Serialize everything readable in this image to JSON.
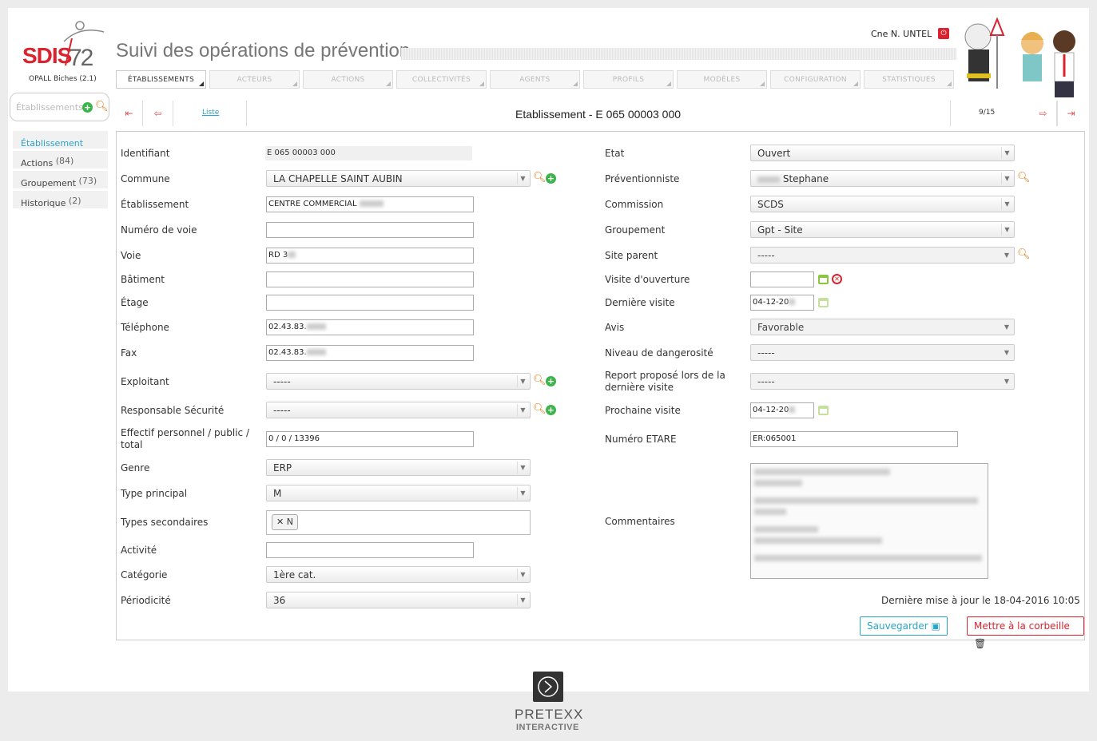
{
  "brand": {
    "logo_sdis": "SDIS",
    "logo_num": "72",
    "version": "OPALL Biches (2.1)",
    "title": "Suivi des opérations de prévention"
  },
  "user": {
    "name": "Cne N. UNTEL"
  },
  "nav": [
    "ÉTABLISSEMENTS",
    "ACTEURS",
    "ACTIONS",
    "COLLECTIVITÉS",
    "AGENTS",
    "PROFILS",
    "MODÈLES",
    "CONFIGURATION",
    "STATISTIQUES"
  ],
  "search": {
    "placeholder": "Établissements"
  },
  "sidebar": [
    {
      "label": "Établissement",
      "count": ""
    },
    {
      "label": "Actions",
      "count": "(84)"
    },
    {
      "label": "Groupement",
      "count": "(73)"
    },
    {
      "label": "Historique",
      "count": "(2)"
    }
  ],
  "record": {
    "list_link": "Liste",
    "title": "Etablissement - E 065 00003 000",
    "counter": "9/15"
  },
  "left": {
    "identifiant": {
      "label": "Identifiant",
      "value": "E 065 00003 000"
    },
    "commune": {
      "label": "Commune",
      "value": "LA CHAPELLE SAINT AUBIN"
    },
    "etablissement": {
      "label": "Établissement",
      "value": "CENTRE COMMERCIAL"
    },
    "numero_voie": {
      "label": "Numéro de voie",
      "value": ""
    },
    "voie": {
      "label": "Voie",
      "value": "RD 3"
    },
    "batiment": {
      "label": "Bâtiment",
      "value": ""
    },
    "etage": {
      "label": "Étage",
      "value": ""
    },
    "telephone": {
      "label": "Téléphone",
      "value": "02.43.83."
    },
    "fax": {
      "label": "Fax",
      "value": "02.43.83."
    },
    "exploitant": {
      "label": "Exploitant",
      "value": "-----"
    },
    "responsable": {
      "label": "Responsable Sécurité",
      "value": "-----"
    },
    "effectif": {
      "label": "Effectif personnel / public / total",
      "value": "0 / 0 / 13396"
    },
    "genre": {
      "label": "Genre",
      "value": "ERP"
    },
    "type_principal": {
      "label": "Type principal",
      "value": "M"
    },
    "types_secondaires": {
      "label": "Types secondaires",
      "tag": "N"
    },
    "activite": {
      "label": "Activité",
      "value": ""
    },
    "categorie": {
      "label": "Catégorie",
      "value": "1ère cat."
    },
    "periodicite": {
      "label": "Périodicité",
      "value": "36"
    }
  },
  "right": {
    "etat": {
      "label": "Etat",
      "value": "Ouvert"
    },
    "preventionniste": {
      "label": "Préventionniste",
      "value": "Stephane"
    },
    "commission": {
      "label": "Commission",
      "value": "SCDS"
    },
    "groupement": {
      "label": "Groupement",
      "value": "Gpt - Site"
    },
    "site_parent": {
      "label": "Site parent",
      "value": "-----"
    },
    "visite_ouverture": {
      "label": "Visite d'ouverture",
      "value": ""
    },
    "derniere_visite": {
      "label": "Dernière visite",
      "value": "04-12-20"
    },
    "avis": {
      "label": "Avis",
      "value": "Favorable"
    },
    "dangerosite": {
      "label": "Niveau de dangerosité",
      "value": "-----"
    },
    "report": {
      "label": "Report proposé lors de la dernière visite",
      "value": "-----"
    },
    "prochaine_visite": {
      "label": "Prochaine visite",
      "value": "04-12-20"
    },
    "etare": {
      "label": "Numéro ETARE",
      "value": "ER:065001"
    },
    "commentaires": {
      "label": "Commentaires"
    }
  },
  "footer": {
    "last_update": "Dernière mise à jour le 18-04-2016 10:05",
    "save": "Sauvegarder",
    "trash": "Mettre à la corbeille"
  },
  "partner": {
    "name": "PRETEXX",
    "sub": "INTERACTIVE"
  }
}
